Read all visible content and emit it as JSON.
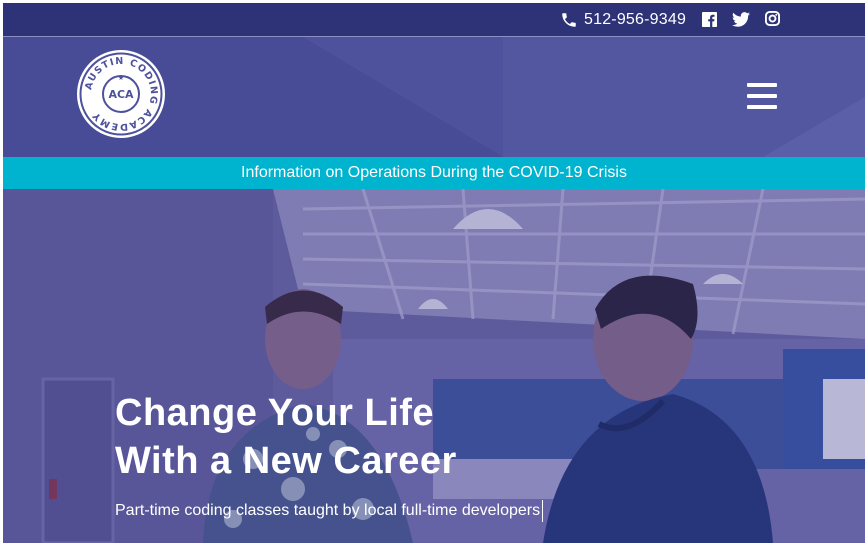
{
  "topbar": {
    "phone": "512-956-9349",
    "icons": [
      "phone-icon",
      "facebook-icon",
      "twitter-icon",
      "instagram-icon"
    ]
  },
  "header": {
    "logo": {
      "ring_text": "AUSTIN CODING ACADEMY",
      "initials": "ACA"
    },
    "menu_icon": "hamburger-menu-icon"
  },
  "banner": {
    "text": "Information on Operations During the COVID-19 Crisis"
  },
  "hero": {
    "title_line1": "Change Your Life",
    "title_line2": "With a New Career",
    "subtitle": "Part-time coding classes taught by local full-time developers"
  },
  "colors": {
    "topbar": "#2e3378",
    "header": "#4e519b",
    "banner": "#00b4d0",
    "text": "#ffffff"
  }
}
